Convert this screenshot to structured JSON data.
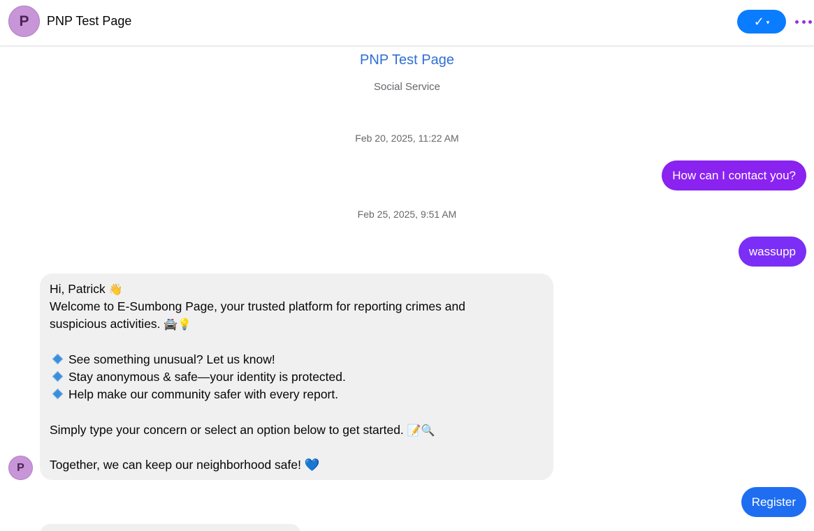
{
  "header": {
    "avatar_letter": "P",
    "title": "PNP Test Page",
    "done_check": "✓",
    "done_caret": "▾",
    "accent_color": "#0a7cff",
    "more_icon": "more-horizontal-icon"
  },
  "profile": {
    "name": "PNP Test Page",
    "category": "Social Service"
  },
  "timestamps": [
    "Feb 20, 2025, 11:22 AM",
    "Feb 25, 2025, 9:51 AM"
  ],
  "messages": {
    "out1": {
      "text": "How can I contact you?",
      "color": "#8a22f0"
    },
    "out2": {
      "text": "wassupp",
      "color": "#7b2ef5"
    },
    "incoming": {
      "avatar_letter": "P",
      "greeting": "Hi, Patrick",
      "greeting_emoji": "👋",
      "welcome_line1": "Welcome to E-Sumbong Page, your trusted platform for reporting crimes and",
      "welcome_line2": "suspicious activities.",
      "welcome_emoji": "🚔💡",
      "bullets": [
        "See something unusual? Let us know!",
        "Stay anonymous & safe—your identity is protected.",
        "Help make our community safer with every report."
      ],
      "instruction": "Simply type your concern or select an option below to get started.",
      "instruction_emoji": "📝🔍",
      "closing": "Together, we can keep our neighborhood safe!",
      "closing_emoji": "💙"
    },
    "out3": {
      "text": "Register",
      "color": "#1f6ef2"
    }
  }
}
